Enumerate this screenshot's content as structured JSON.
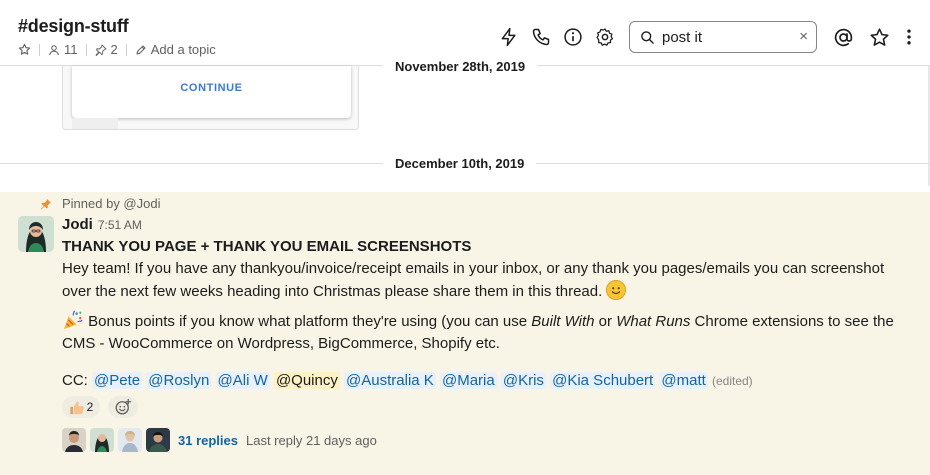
{
  "channel": {
    "name": "#design-stuff",
    "members": "11",
    "pins": "2",
    "add_topic": "Add a topic"
  },
  "header_icons": [
    "activity-bolt-icon",
    "phone-icon",
    "info-icon",
    "gear-icon",
    "mention-at-icon",
    "star-icon",
    "more-vertical-icon"
  ],
  "search": {
    "value": "post it",
    "clear": "×"
  },
  "attachment": {
    "button_label": "CONTINUE"
  },
  "dates": {
    "first": "November 28th, 2019",
    "second": "December 10th, 2019"
  },
  "message": {
    "pinned_by": "Pinned by @Jodi",
    "author": "Jodi",
    "time": "7:51 AM",
    "heading": "THANK YOU PAGE + THANK YOU EMAIL SCREENSHOTS",
    "para1": "Hey team! If you have any thankyou/invoice/receipt emails in your inbox, or any thank you pages/emails you can screenshot over the next few weeks heading into Christmas please share them in this thread.",
    "para2_a": "Bonus points if you know what platform they're using (you can use ",
    "para2_built": "Built With",
    "para2_or": " or ",
    "para2_what": "What Runs",
    "para2_b": " Chrome extensions to see the CMS - WooCommerce on Wordpress, BigCommerce, Shopify etc.",
    "cc_label": "CC:",
    "mentions": [
      "@Pete",
      "@Roslyn",
      "@Ali W",
      "@Quincy",
      "@Australia K",
      "@Maria",
      "@Kris",
      "@Kia Schubert",
      "@matt"
    ],
    "edited": "(edited)"
  },
  "reactions": {
    "thumbs_count": "2"
  },
  "thread": {
    "replies": "31 replies",
    "last_reply": "Last reply 21 days ago"
  },
  "colors": {
    "pinned_bg": "#f8f4e6",
    "link": "#1264a3",
    "mention_bg": "#e8f1f9",
    "self_mention_bg": "#fdf2c6"
  }
}
